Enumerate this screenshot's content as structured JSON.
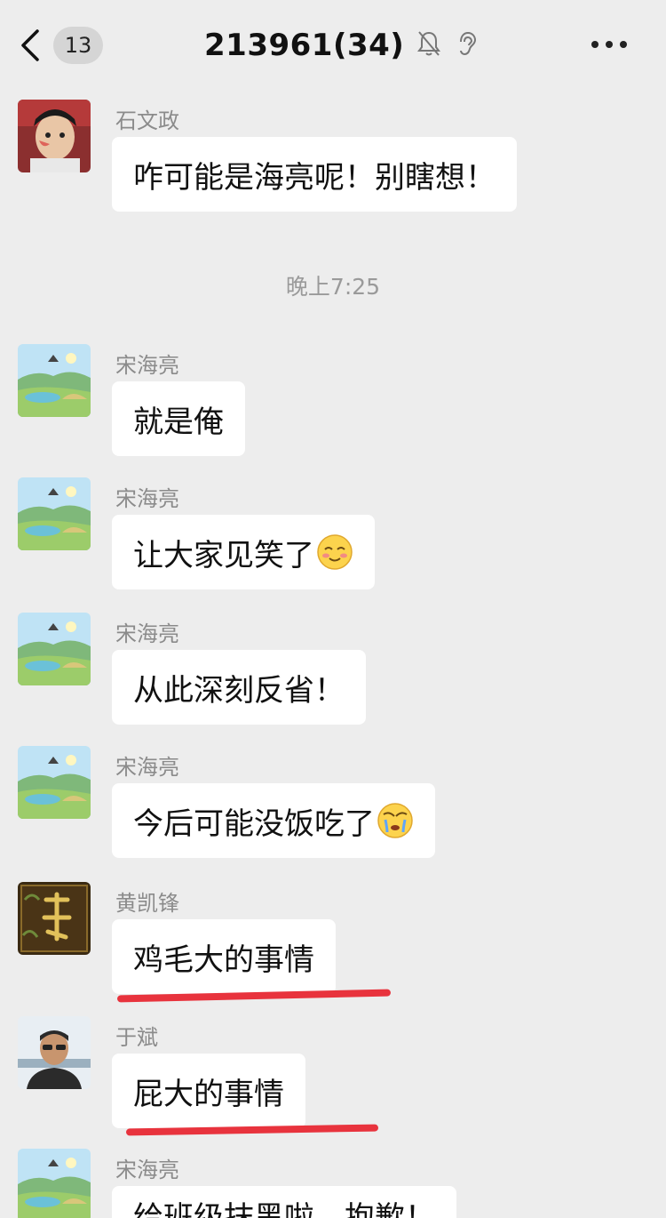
{
  "header": {
    "back_badge": "13",
    "title": "213961(34)",
    "mute_icon": "bell-off-icon",
    "ear_icon": "ear-icon",
    "more_icon": "more-icon"
  },
  "timestamp": "晚上7:25",
  "messages": [
    {
      "sender": "石文政",
      "text": "咋可能是海亮呢！别瞎想！",
      "avatar": "boy-photo"
    },
    {
      "sender": "宋海亮",
      "text": "就是俺",
      "avatar": "landscape"
    },
    {
      "sender": "宋海亮",
      "text": "让大家见笑了",
      "emoji": "shy-smile-emoji",
      "avatar": "landscape"
    },
    {
      "sender": "宋海亮",
      "text": "从此深刻反省！",
      "avatar": "landscape"
    },
    {
      "sender": "宋海亮",
      "text": "今后可能没饭吃了",
      "emoji": "facepalm-emoji",
      "avatar": "landscape"
    },
    {
      "sender": "黄凯锋",
      "text": "鸡毛大的事情",
      "avatar": "calligraphy"
    },
    {
      "sender": "于斌",
      "text": "屁大的事情",
      "avatar": "man-photo"
    },
    {
      "sender": "宋海亮",
      "text": "给班级抹黑啦，抱歉！",
      "avatar": "landscape"
    }
  ],
  "colors": {
    "background": "#ededed",
    "bubble": "#ffffff",
    "underline": "#e8333d"
  }
}
